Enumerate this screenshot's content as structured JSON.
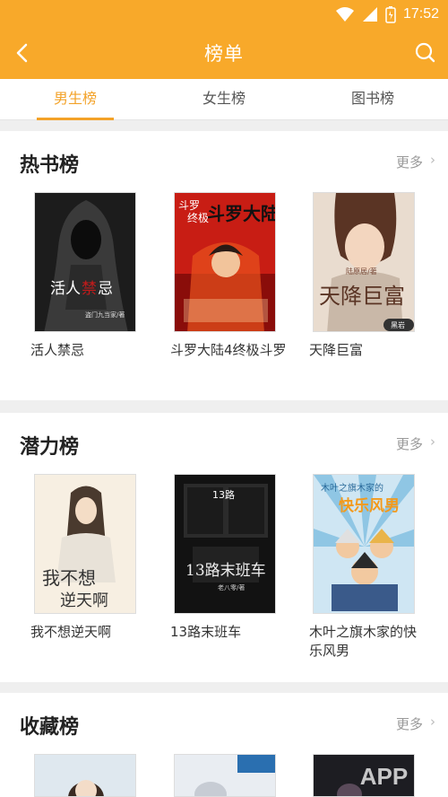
{
  "status": {
    "time": "17:52"
  },
  "header": {
    "title": "榜单"
  },
  "tabs": [
    {
      "label": "男生榜",
      "active": true
    },
    {
      "label": "女生榜",
      "active": false
    },
    {
      "label": "图书榜",
      "active": false
    }
  ],
  "sections": [
    {
      "title": "热书榜",
      "more": "更多",
      "books": [
        {
          "title": "活人禁忌",
          "cover_text": [
            "活人",
            "禁",
            "忌"
          ],
          "cover_author": "盗门九当家/著"
        },
        {
          "title": "斗罗大陆4终极斗罗",
          "cover_text": [
            "斗罗",
            "终极",
            "斗罗大陆"
          ]
        },
        {
          "title": "天降巨富",
          "cover_text": [
            "天降巨富"
          ],
          "cover_author": "陆原居/著",
          "cover_badge": "黑岩"
        }
      ]
    },
    {
      "title": "潜力榜",
      "more": "更多",
      "books": [
        {
          "title": "我不想逆天啊",
          "cover_text": [
            "我不想",
            "逆天啊"
          ]
        },
        {
          "title": "13路末班车",
          "cover_text": [
            "13路",
            "13路末班车"
          ],
          "cover_author": "老八零/著"
        },
        {
          "title": "木叶之旗木家的快乐风男",
          "cover_text": [
            "木叶之旗木家的",
            "快乐风男"
          ]
        }
      ]
    },
    {
      "title": "收藏榜",
      "more": "更多",
      "books": []
    }
  ],
  "watermark": "APP 西",
  "colors": {
    "accent": "#f8a92a",
    "tab_active": "#f3a228"
  }
}
